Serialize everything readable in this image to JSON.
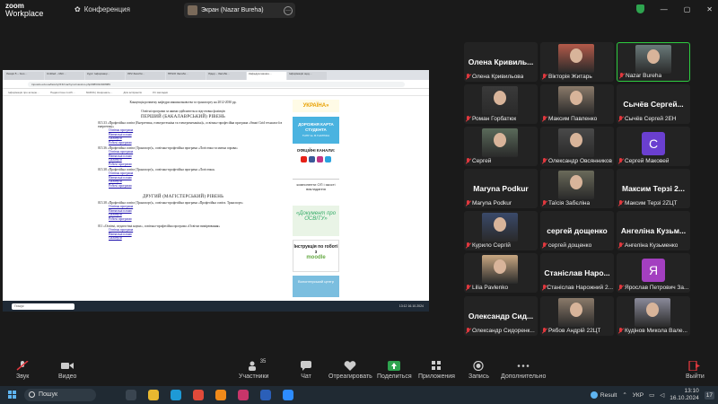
{
  "zoom": {
    "logo_line1": "zoom",
    "logo_line2": "Workplace",
    "meeting_label": "Конференция",
    "share_label": "Экран (Nazar Bureha)",
    "share_menu": "···",
    "window_controls": [
      "shield-icon",
      "—",
      "▢",
      "✕"
    ]
  },
  "browser": {
    "tabs": [
      "Лекція 5 – Goo…",
      "Untitled – Micr…",
      "Курс: Інформаці…",
      "ЛР2 Засоби…",
      "ПРЖО Засоби…",
      "Лідер – Засоби…",
      "Кафедра машин…",
      "Інформація щод…"
    ],
    "url": "tnpusdu.edu.ua/faculty/IFF/machynoznavstvo.php#086432028989",
    "bookmarks": [
      "Інформація про асоцію…",
      "Педагогічне посіб…",
      "NADIIA | Національ…",
      "Для аспірантів",
      "Усі закладки"
    ]
  },
  "document": {
    "heading": "Концепція розвитку кафедри машинознавства та транспорту на 2012-2030 рр.",
    "subheading": "Освітні програми за якими здійснюється підготовка фахівців",
    "level1": "ПЕРШИЙ (БАКАЛАВРСЬКИЙ) РІВЕНЬ",
    "program1": "015.33 «Професійна освіта (Енергетика, електротехніка та електромеханіка)», освітньо-професійна програма «Smart Grid технології в енергетиці»",
    "links1": [
      "Освітня програма",
      "Навчальні плани",
      "Силабуси",
      "Робочі програми"
    ],
    "program2": "015.36 «Професійна освіта (Транспорт)», освітньо-професійна програма «Логістика та митна справа»",
    "links2": [
      "Освітня програма",
      "Навчальні плани",
      "Силабуси",
      "Робочі програми"
    ],
    "program3": "015.38 «Професійна освіта (Транспорт)», освітньо-професійна програма «Логістика»",
    "links3": [
      "Освітня програма",
      "Навчальні плани",
      "Силабуси",
      "Робочі програми"
    ],
    "level2": "ДРУГИЙ (МАГІСТЕРСЬКИЙ) РІВЕНЬ",
    "program4": "015.38 «Професійна освіта (Транспорт)», освітньо-професійна програма «Професійна освіта. Транспорт»",
    "links4": [
      "Освітня програма",
      "Навчальні плани",
      "Силабуси",
      "Робочі програми"
    ],
    "program5": "011 «Освітні, педагогічні науки», освітньо-професійна програма «Освітнє вимірювання»",
    "links5": [
      "Освітня програма",
      "Навчальні плани",
      "Силабуси"
    ]
  },
  "site_sidebar": {
    "banner1": "УКРАЇНА»",
    "banner2": "ДОРОЖНЯ КАРТА СТУДЕНТА",
    "banner2_sub": "ТНПУ ім. В.ГНАТЮКА",
    "banner3": "ОФІЦІЙНІ КАНАЛИ:",
    "banner4": "компоненти ОП і якості викладання",
    "banner5": "«Документ про ОСВІТУ»",
    "banner6": "Інструкція по roботі з",
    "banner6_brand": "moodle",
    "banner7": "Волонтерський центр"
  },
  "remote_taskbar": {
    "search": "Пошук",
    "time": "13:12 16.10.2024"
  },
  "participants": [
    {
      "name": "Олена  Кривиль...",
      "caption": "Олена Кривильова",
      "video": false
    },
    {
      "name": "",
      "caption": "Вікторія Житарь",
      "video": true,
      "tone": "#b45a4a"
    },
    {
      "name": "",
      "caption": "Nazar Bureha",
      "video": true,
      "tone": "#6a7a7a",
      "speaking": true
    },
    {
      "name": "",
      "caption": "Роман Горбатюк",
      "video": true,
      "tone": "#3a3a3a"
    },
    {
      "name": "",
      "caption": "Максим Павленко",
      "video": true,
      "tone": "#8a7a6a"
    },
    {
      "name": "Сычёв  Сергей...",
      "caption": "Сычёв Сергей 2ЕН",
      "video": false
    },
    {
      "name": "",
      "caption": "Сергей",
      "video": true,
      "tone": "#5a6a5a"
    },
    {
      "name": "",
      "caption": "Олександр Овсянников",
      "video": true,
      "tone": "#4a4a4a"
    },
    {
      "name": "",
      "caption": "Сергей Маковей",
      "avatar": "С",
      "avatar_color": "#6a3fd0"
    },
    {
      "name": "Maryna Podkur",
      "caption": "Maryna Podkur",
      "video": false
    },
    {
      "name": "",
      "caption": "Таїсія Забєліна",
      "video": true,
      "tone": "#6a6a5a"
    },
    {
      "name": "Максим  Терзі 2...",
      "caption": "Максим Терзі 2ZЦТ",
      "video": false
    },
    {
      "name": "",
      "caption": "Курило Сергій",
      "video": true,
      "tone": "#3a4a6a"
    },
    {
      "name": "сергей  дощенко",
      "caption": "сергей дощенко",
      "video": false
    },
    {
      "name": "Ангеліна  Кузьм...",
      "caption": "Ангеліна Кузьменко",
      "video": false
    },
    {
      "name": "",
      "caption": "Lilia Pavlenko",
      "video": true,
      "tone": "#c9a882"
    },
    {
      "name": "Станіслав  Наро...",
      "caption": "Станіслав Нарожний 2...",
      "video": false
    },
    {
      "name": "",
      "caption": "Ярослав Петрович За...",
      "avatar": "Я",
      "avatar_color": "#a33fc0"
    },
    {
      "name": "Олександр  Сид...",
      "caption": "Олександр Сидоренк...",
      "video": false
    },
    {
      "name": "",
      "caption": "Рябов Андрій 22ЦТ",
      "video": true,
      "tone": "#8a7a6a"
    },
    {
      "name": "",
      "caption": "Кудінов Микола Вале...",
      "video": true,
      "tone": "#8a8a9a"
    }
  ],
  "toolbar": {
    "audio": "Звук",
    "video": "Видео",
    "participants": "Участники",
    "participants_count": "35",
    "chat": "Чат",
    "react": "Отреагировать",
    "share": "Поделиться",
    "apps": "Приложения",
    "record": "Запись",
    "more": "Дополнительно",
    "leave": "Выйти"
  },
  "taskbar": {
    "search": "Пошук",
    "result_label": "Result",
    "lang": "УКР",
    "time": "13:10",
    "date": "16.10.2024",
    "notif_count": "17"
  },
  "colors": {
    "speaking_border": "#2ecc40",
    "muted": "#e0383e",
    "share_accent": "#2ea44f",
    "leave": "#e0383e"
  }
}
